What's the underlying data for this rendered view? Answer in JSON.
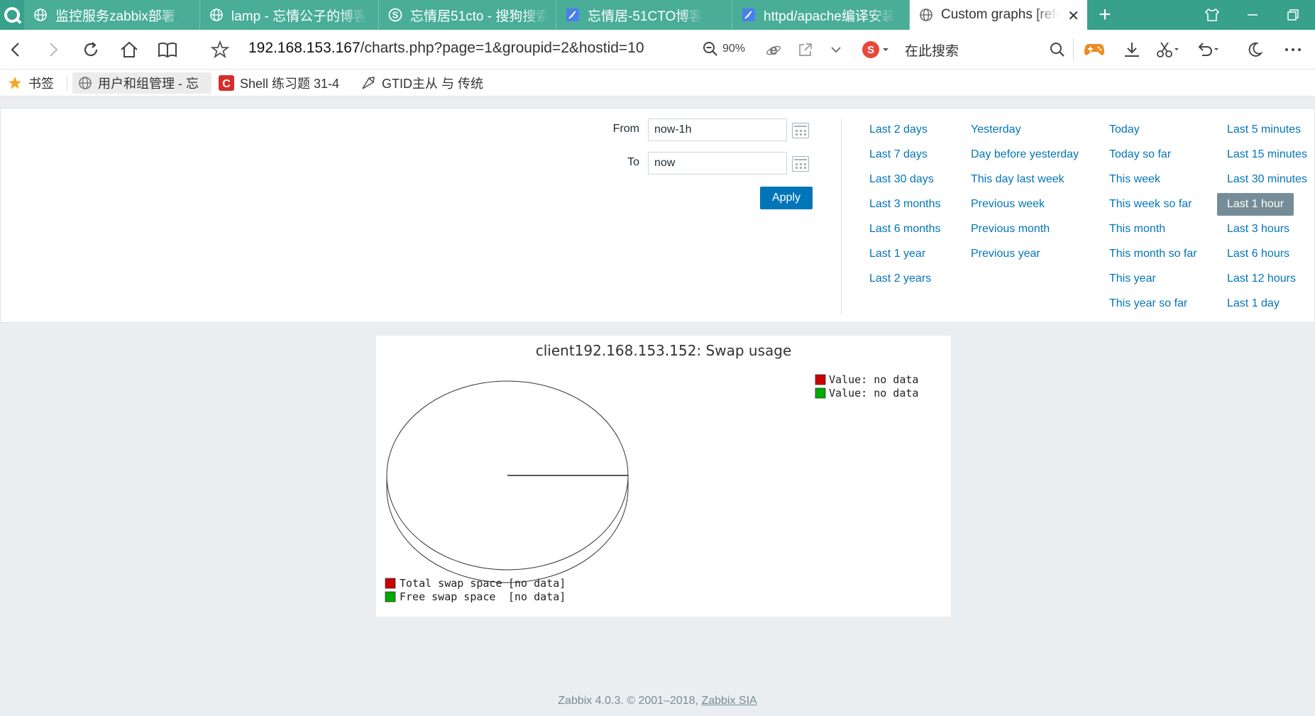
{
  "browser": {
    "tabs": [
      {
        "label": "监控服务zabbix部署 -",
        "active": false
      },
      {
        "label": "lamp - 忘情公子的博客",
        "active": false
      },
      {
        "label": "忘情居51cto - 搜狗搜索",
        "active": false
      },
      {
        "label": "忘情居-51CTO博客",
        "active": false
      },
      {
        "label": "httpd/apache编译安装",
        "active": false
      },
      {
        "label": "Custom graphs [refreshed",
        "active": true
      }
    ],
    "new_tab": "+",
    "url_host": "192.168.153.167",
    "url_path": "/charts.php?page=1&groupid=2&hostid=10",
    "zoom": "90%",
    "search_placeholder": "在此搜索",
    "bookmarks": [
      {
        "label": "书签"
      },
      {
        "label": "用户和组管理 - 忘"
      },
      {
        "label": "Shell 练习题 31-4"
      },
      {
        "label": "GTID主从 与 传统"
      }
    ]
  },
  "filter": {
    "from_label": "From",
    "from_value": "now-1h",
    "to_label": "To",
    "to_value": "now",
    "apply_label": "Apply",
    "columns": [
      [
        "Last 2 days",
        "Last 7 days",
        "Last 30 days",
        "Last 3 months",
        "Last 6 months",
        "Last 1 year",
        "Last 2 years"
      ],
      [
        "Yesterday",
        "Day before yesterday",
        "This day last week",
        "Previous week",
        "Previous month",
        "Previous year"
      ],
      [
        "Today",
        "Today so far",
        "This week",
        "This week so far",
        "This month",
        "This month so far",
        "This year",
        "This year so far"
      ],
      [
        "Last 5 minutes",
        "Last 15 minutes",
        "Last 30 minutes",
        "Last 1 hour",
        "Last 3 hours",
        "Last 6 hours",
        "Last 12 hours",
        "Last 1 day"
      ]
    ],
    "selected": "Last 1 hour"
  },
  "chart_data": {
    "type": "pie",
    "title": "client192.168.153.152: Swap usage",
    "series": [
      {
        "name": "Total swap space",
        "value_label": "[no data]",
        "color": "#cc0000"
      },
      {
        "name": "Free swap space",
        "value_label": "[no data]",
        "color": "#00aa00"
      }
    ],
    "legend_top": [
      {
        "label": "Value: no data",
        "color": "#cc0000"
      },
      {
        "label": "Value: no data",
        "color": "#00aa00"
      }
    ],
    "style": "3d"
  },
  "footer": {
    "text": "Zabbix 4.0.3. © 2001–2018, ",
    "link": "Zabbix SIA"
  }
}
